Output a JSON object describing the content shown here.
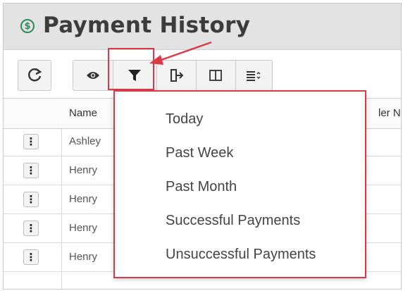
{
  "page": {
    "title": "Payment History",
    "title_icon": "dollar-circle-icon",
    "title_icon_glyph": "$"
  },
  "toolbar": {
    "refresh_icon": "refresh-icon",
    "refresh_glyph": "C",
    "buttons": [
      {
        "icon": "eye-icon"
      },
      {
        "icon": "filter-icon"
      },
      {
        "icon": "export-icon"
      },
      {
        "icon": "columns-icon"
      },
      {
        "icon": "list-settings-icon"
      }
    ]
  },
  "table": {
    "columns": [
      "Name",
      "ler Nu"
    ],
    "rows": [
      {
        "name": "Ashley"
      },
      {
        "name": "Henry"
      },
      {
        "name": "Henry"
      },
      {
        "name": "Henry"
      },
      {
        "name": "Henry"
      }
    ],
    "row_menu_glyph": "⋮"
  },
  "filter_menu": {
    "items": [
      "Today",
      "Past Week",
      "Past Month",
      "Successful Payments",
      "Unsuccessful Payments"
    ]
  },
  "colors": {
    "highlight": "#d93b48",
    "title_icon": "#2e8b57",
    "header_bg": "#e3e3e3"
  }
}
